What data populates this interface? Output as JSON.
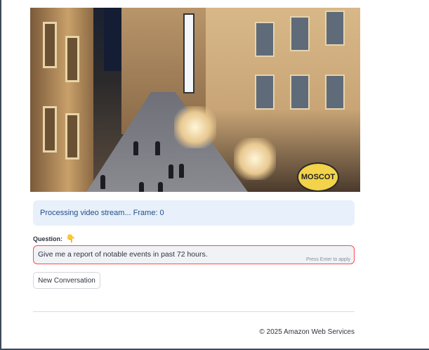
{
  "video": {
    "scene": "street-camera-feed",
    "store_sign": "MOSCOT",
    "hotel_sign": "SILVERHO"
  },
  "status": {
    "text": "Processing video stream... Frame: 0"
  },
  "question": {
    "label": "Question:",
    "icon": "pointing-down-icon",
    "value": "Give me a report of notable events in past 72 hours.",
    "hint": "Press Enter to apply"
  },
  "actions": {
    "new_conversation_label": "New Conversation"
  },
  "footer": {
    "text": "© 2025 Amazon Web Services"
  },
  "colors": {
    "status_bg": "#e8f0fb",
    "status_text": "#1f4e8a",
    "input_focus_border": "#ff4b4b"
  }
}
